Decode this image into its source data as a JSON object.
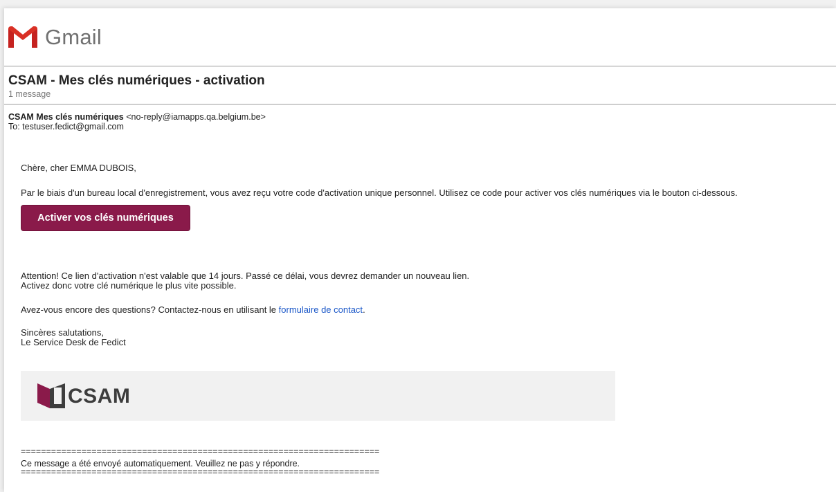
{
  "app": {
    "name": "Gmail"
  },
  "thread": {
    "subject": "CSAM - Mes clés numériques - activation",
    "count": "1 message"
  },
  "email": {
    "sender_name": "CSAM Mes clés numériques",
    "sender_address": "<no-reply@iamapps.qa.belgium.be>",
    "to": "To: testuser.fedict@gmail.com",
    "greeting": "Chère, cher EMMA DUBOIS,",
    "intro": "Par le biais d'un bureau local d'enregistrement, vous avez reçu votre code d'activation unique personnel. Utilisez ce code pour activer vos clés numériques via le bouton ci-dessous.",
    "button_label": "Activer vos clés numériques",
    "warning_line1": "Attention! Ce lien d'activation n'est valable que 14 jours. Passé ce délai, vous devrez demander un nouveau lien.",
    "warning_line2": "Activez donc votre clé numérique le plus vite possible.",
    "questions_prefix": "Avez-vous encore des questions? Contactez-nous en utilisant le ",
    "contact_link": "formulaire de contact",
    "questions_suffix": ".",
    "closing1": "Sincères salutations,",
    "closing2": "Le Service Desk de Fedict",
    "banner_brand": "CSAM",
    "separator": "=======================================================================",
    "auto_notice": "Ce message a été envoyé automatiquement. Veuillez ne pas y répondre."
  },
  "colors": {
    "button": "#8a1a4a",
    "link": "#1a57c8",
    "gmail_red": "#d93025"
  }
}
